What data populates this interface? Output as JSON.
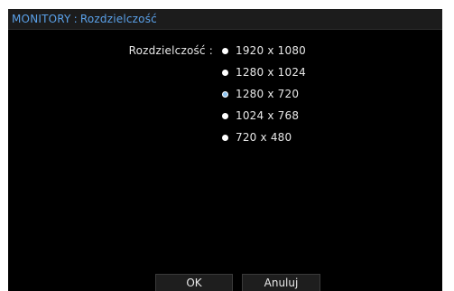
{
  "title_bar": {
    "app": "MONITORY",
    "separator": ":",
    "page": "Rozdzielczość"
  },
  "resolution": {
    "label": "Rozdzielczość :",
    "selected_index": 2,
    "options": [
      {
        "label": "1920 x 1080"
      },
      {
        "label": "1280 x 1024"
      },
      {
        "label": "1280 x 720"
      },
      {
        "label": "1024 x 768"
      },
      {
        "label": "720 x 480"
      }
    ]
  },
  "buttons": {
    "ok": "OK",
    "cancel": "Anuluj"
  },
  "colors": {
    "title_text": "#5aa0e8",
    "selected_radio": "#8ec4f0",
    "background": "#000000"
  }
}
